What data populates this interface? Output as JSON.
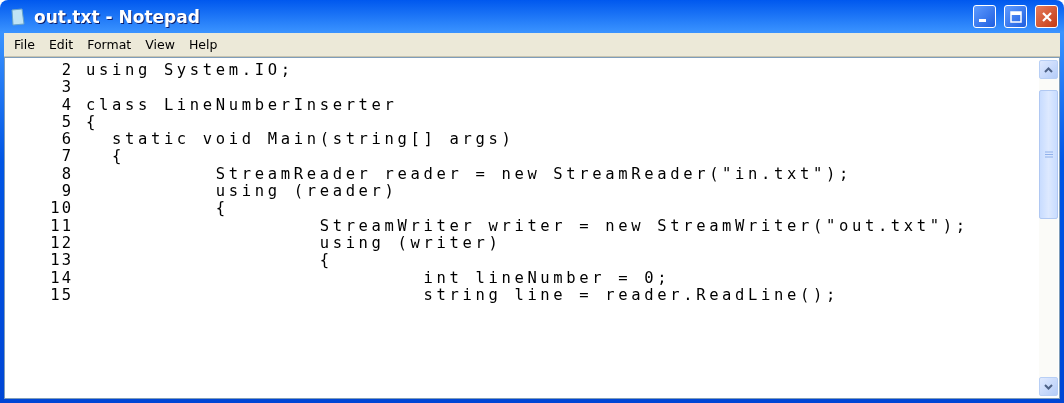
{
  "window": {
    "title": "out.txt - Notepad"
  },
  "menu": [
    "File",
    "Edit",
    "Format",
    "View",
    "Help"
  ],
  "lines": [
    {
      "number": "2",
      "text": "using System.IO;"
    },
    {
      "number": "3"
    },
    {
      "number": "4",
      "text": "class LineNumberInserter"
    },
    {
      "number": "5",
      "text": "{"
    },
    {
      "number": "6",
      "text": "  static void Main(string[] args)"
    },
    {
      "number": "7",
      "text": "  {"
    },
    {
      "number": "8",
      "text": "          StreamReader reader = new StreamReader(\"in.txt\");"
    },
    {
      "number": "9",
      "text": "          using (reader)"
    },
    {
      "number": "10",
      "text": "          {"
    },
    {
      "number": "11",
      "text": "                  StreamWriter writer = new StreamWriter(\"out.txt\");"
    },
    {
      "number": "12",
      "text": "                  using (writer)"
    },
    {
      "number": "13",
      "text": "                  {"
    },
    {
      "number": "14",
      "text": "                          int lineNumber = 0;"
    },
    {
      "number": "15",
      "text": "                          string line = reader.ReadLine();"
    }
  ]
}
